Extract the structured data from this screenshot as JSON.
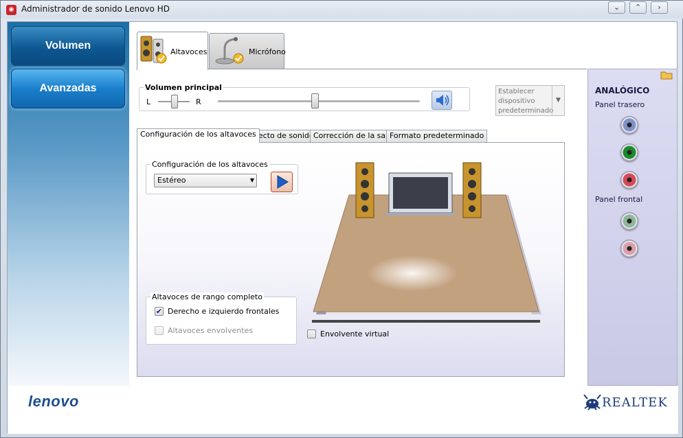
{
  "window": {
    "title": "Administrador de sonido Lenovo HD",
    "buttons": {
      "minimize": "⌄",
      "maximize": "⌃",
      "close": "›"
    }
  },
  "nav": {
    "volume_label": "Volumen",
    "advanced_label": "Avanzadas"
  },
  "device_tabs": {
    "speakers_label": "Altavoces",
    "microphone_label": "Micrófono"
  },
  "volume": {
    "group_title": "Volumen principal",
    "balance_left": "L",
    "balance_right": "R",
    "level": 0.48
  },
  "set_default": {
    "label": "Establecer dispositivo predeterminado"
  },
  "sub_tabs": [
    "Configuración de los altavoces",
    "Efecto de sonido",
    "Corrección de la sala",
    "Formato predeterminado"
  ],
  "speaker_config": {
    "group_title": "Configuración de los altavoces",
    "selected": "Estéreo"
  },
  "full_range": {
    "group_title": "Altavoces de rango completo",
    "front_label": "Derecho e izquierdo frontales",
    "front_checked": "✔",
    "surround_label": "Altavoces envolventes"
  },
  "virtual_surround": {
    "label": "Envolvente virtual"
  },
  "analog": {
    "title": "ANALÓGICO",
    "rear_panel": "Panel trasero",
    "front_panel": "Panel frontal",
    "colors": {
      "blue": "#7f93c9",
      "green": "#1c8a2b",
      "red": "#d64a58",
      "green_dim": "#8fb69a",
      "red_dim": "#dca0ab"
    }
  },
  "brands": {
    "lenovo": "lenovo",
    "realtek": "REALTEK"
  }
}
